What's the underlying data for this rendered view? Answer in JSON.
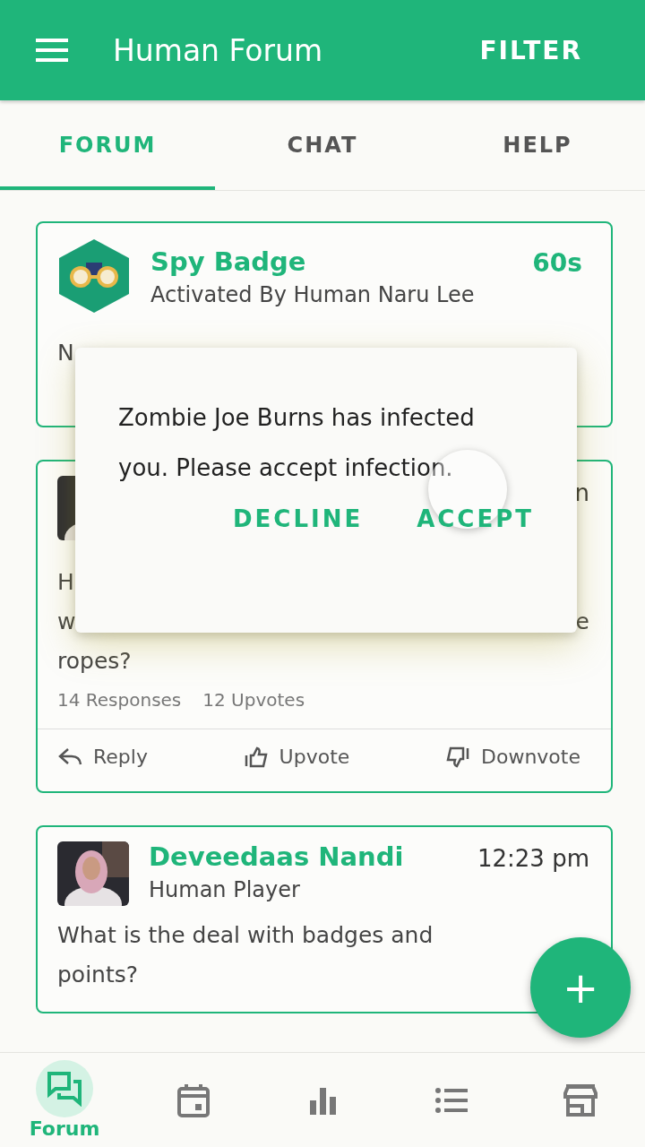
{
  "app_bar": {
    "title": "Human Forum",
    "action": "FILTER"
  },
  "tabs": [
    {
      "label": "FORUM",
      "selected": true
    },
    {
      "label": "CHAT",
      "selected": false
    },
    {
      "label": "HELP",
      "selected": false
    }
  ],
  "posts": [
    {
      "kind": "badge",
      "title": "Spy Badge",
      "subtitle": "Activated By Human Naru Lee",
      "time": "60s",
      "body_lines": [
        {
          "left": "N"
        }
      ]
    },
    {
      "kind": "question",
      "avatar": {
        "kind": "picture"
      },
      "time": "n",
      "body_lines": [
        {
          "left": "H"
        },
        {
          "left": "w",
          "right": "e"
        },
        {
          "left": "ropes?"
        }
      ],
      "stats": [
        "14 Responses",
        "12 Upvotes"
      ],
      "actions": [
        {
          "kind": "reply",
          "label": "Reply"
        },
        {
          "kind": "upvote",
          "label": "Upvote"
        },
        {
          "kind": "downvote",
          "label": "Downvote"
        }
      ]
    },
    {
      "kind": "question",
      "avatar": {
        "kind": "picture"
      },
      "name": "Deveedaas Nandi",
      "role": "Human Player",
      "time": "12:23 pm",
      "body_lines": [
        {
          "left": "What is the deal with badges and"
        },
        {
          "left": "points?"
        }
      ]
    }
  ],
  "dialog": {
    "message": "Zombie Joe Burns has infected you. Please accept infection.",
    "buttons": [
      {
        "label": "DECLINE",
        "pressed": false
      },
      {
        "label": "ACCEPT",
        "pressed": true
      }
    ]
  },
  "fab": {
    "label": "+"
  },
  "bottom_nav": [
    {
      "kind": "forum",
      "label": "Forum",
      "selected": true
    },
    {
      "kind": "calendar",
      "selected": false
    },
    {
      "kind": "chart",
      "selected": false
    },
    {
      "kind": "list",
      "selected": false
    },
    {
      "kind": "store",
      "selected": false
    }
  ]
}
